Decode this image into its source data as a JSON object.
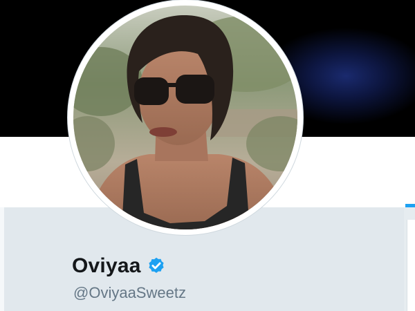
{
  "profile": {
    "display_name": "Oviyaa",
    "screen_name": "@OviyaaSweetz",
    "verified": true
  },
  "icons": {
    "verified": "verified-badge-icon"
  },
  "colors": {
    "accent": "#1da1f2",
    "name_text": "#14171a",
    "handle_text": "#657786",
    "page_background": "#e6ecf0"
  }
}
